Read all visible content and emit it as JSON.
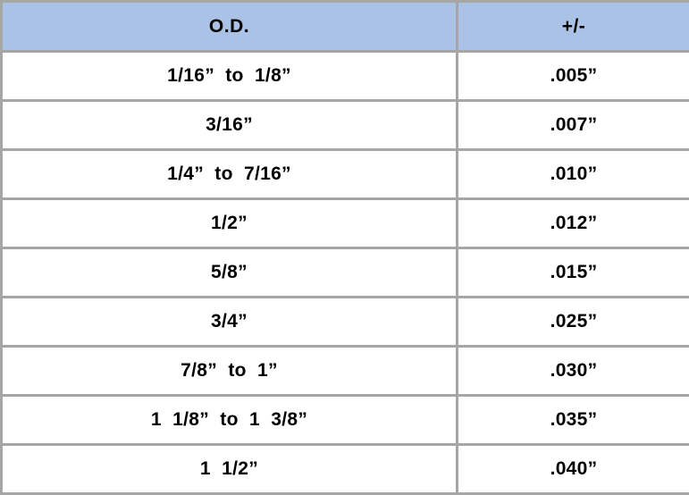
{
  "table": {
    "name": "outside-diameter-tolerance-table",
    "columns": [
      {
        "key": "od",
        "label": "O.D."
      },
      {
        "key": "tolerance",
        "label": "+/-"
      }
    ],
    "header_bg": "#aac2e5",
    "border_color": "#a6a6a6",
    "text_color": "#000000",
    "rows": [
      {
        "od": "1/16”  to  1/8”",
        "tolerance": ".005”"
      },
      {
        "od": "3/16”",
        "tolerance": ".007”"
      },
      {
        "od": "1/4”  to  7/16”",
        "tolerance": ".010”"
      },
      {
        "od": "1/2”",
        "tolerance": ".012”"
      },
      {
        "od": "5/8”",
        "tolerance": ".015”"
      },
      {
        "od": "3/4”",
        "tolerance": ".025”"
      },
      {
        "od": "7/8”  to  1”",
        "tolerance": ".030”"
      },
      {
        "od": "1  1/8”  to  1  3/8”",
        "tolerance": ".035”"
      },
      {
        "od": "1  1/2”",
        "tolerance": ".040”"
      }
    ]
  }
}
